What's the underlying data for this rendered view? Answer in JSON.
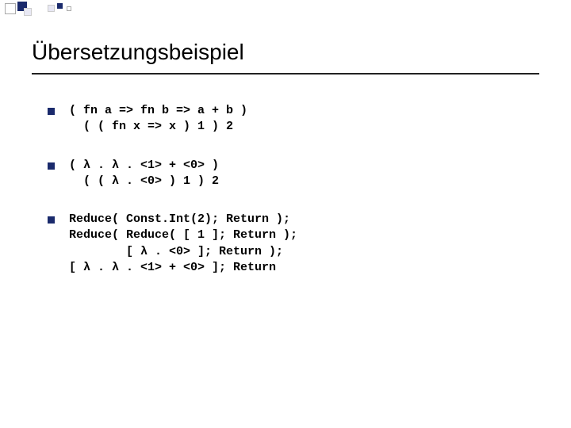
{
  "title": "Übersetzungsbeispiel",
  "items": [
    "( fn a => fn b => a + b )\n  ( ( fn x => x ) 1 ) 2",
    "( λ . λ . <1> + <0> )\n  ( ( λ . <0> ) 1 ) 2",
    "Reduce( Const.Int(2); Return );\nReduce( Reduce( [ 1 ]; Return );\n        [ λ . <0> ]; Return );\n[ λ . λ . <1> + <0> ]; Return"
  ]
}
